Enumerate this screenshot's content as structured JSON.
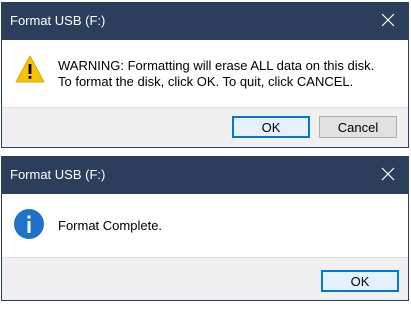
{
  "dialogs": [
    {
      "title": "Format USB (F:)",
      "icon": "warning-icon",
      "message_line1": "WARNING: Formatting will erase ALL data on this disk.",
      "message_line2": "To format the disk, click OK. To quit, click CANCEL.",
      "ok_label": "OK",
      "cancel_label": "Cancel"
    },
    {
      "title": "Format USB (F:)",
      "icon": "info-icon",
      "message": "Format Complete.",
      "ok_label": "OK"
    }
  ],
  "colors": {
    "titlebar": "#2b3f5c",
    "footer": "#f0f0f0",
    "warning": "#f5c400",
    "info": "#1e73c8",
    "focus_border": "#0078d7"
  }
}
